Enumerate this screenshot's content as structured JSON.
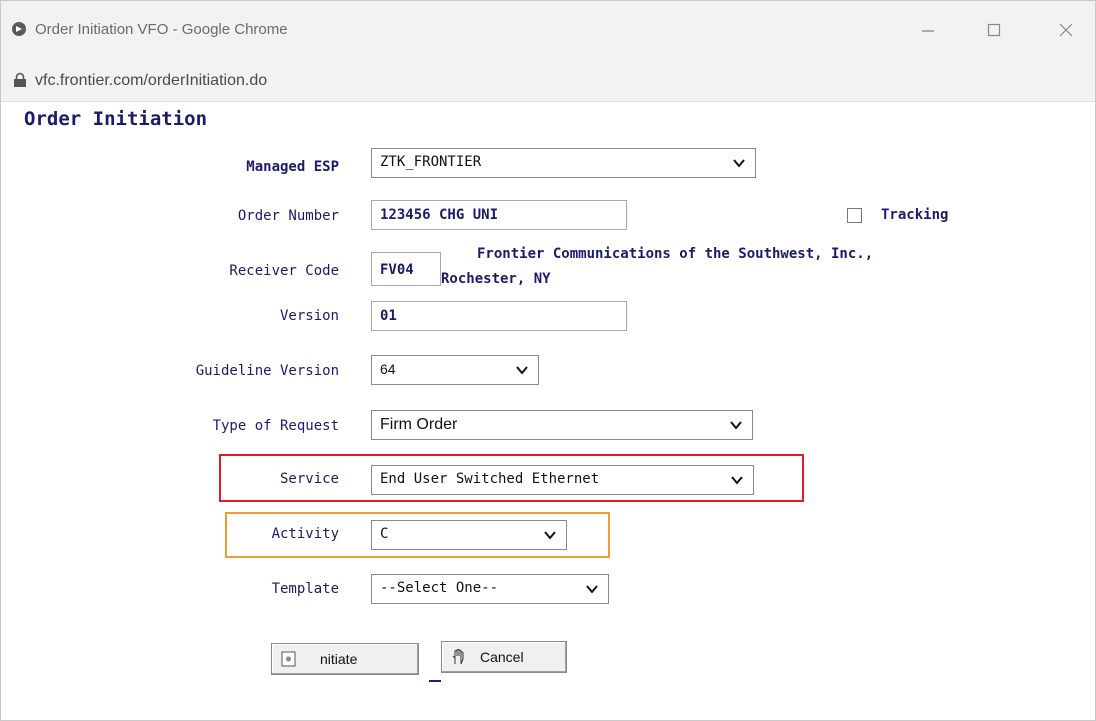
{
  "window": {
    "title": "Order Initiation VFO - Google Chrome",
    "url": "vfc.frontier.com/orderInitiation.do"
  },
  "page": {
    "title": "Order Initiation"
  },
  "form": {
    "managed_esp": {
      "label": "Managed ESP",
      "value": "ZTK_FRONTIER"
    },
    "order_number": {
      "label": "Order Number",
      "value": "123456 CHG UNI"
    },
    "tracking": {
      "label": "Tracking",
      "checked": false
    },
    "receiver_code": {
      "label": "Receiver Code",
      "value": "FV04",
      "description_line1": "Frontier Communications of the Southwest, Inc.,",
      "description_line2": "Rochester, NY"
    },
    "version": {
      "label": "Version",
      "value": "01"
    },
    "guideline_version": {
      "label": "Guideline Version",
      "value": "64"
    },
    "type_of_request": {
      "label": "Type of Request",
      "value": "Firm Order"
    },
    "service": {
      "label": "Service",
      "value": "End User Switched Ethernet"
    },
    "activity": {
      "label": "Activity",
      "value": "C"
    },
    "template": {
      "label": "Template",
      "value": "--Select One--"
    }
  },
  "buttons": {
    "initiate": "nitiate",
    "cancel": "Cancel"
  },
  "colors": {
    "label_text": "#1b1b6b",
    "highlight_service": "#e01c2a",
    "highlight_activity": "#f39a35"
  },
  "icons": [
    "globe-icon",
    "minimize-icon",
    "maximize-icon",
    "close-icon",
    "lock-icon",
    "chevron-down-icon",
    "initiate-icon",
    "cancel-hand-icon"
  ]
}
